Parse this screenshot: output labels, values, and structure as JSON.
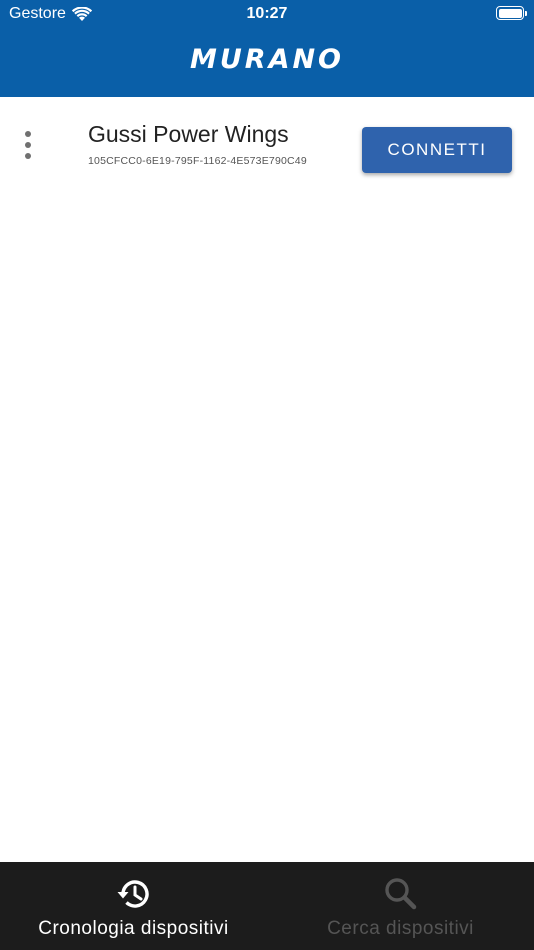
{
  "status_bar": {
    "carrier": "Gestore",
    "time": "10:27",
    "wifi_icon": "wifi-icon",
    "battery_icon": "battery-icon"
  },
  "header": {
    "brand": "MURANO"
  },
  "devices": [
    {
      "name": "Gussi Power Wings",
      "id": "105CFCC0-6E19-795F-1162-4E573E790C49",
      "connect_label": "CONNETTI",
      "menu_icon": "more-vertical-icon"
    }
  ],
  "tabs": [
    {
      "label": "Cronologia dispositivi",
      "icon": "history-icon",
      "active": true
    },
    {
      "label": "Cerca dispositivi",
      "icon": "search-icon",
      "active": false
    }
  ],
  "colors": {
    "header_bg": "#0a5fa8",
    "button_bg": "#2f63ad",
    "tab_bar_bg": "#1c1c1c",
    "tab_inactive": "#555555"
  }
}
